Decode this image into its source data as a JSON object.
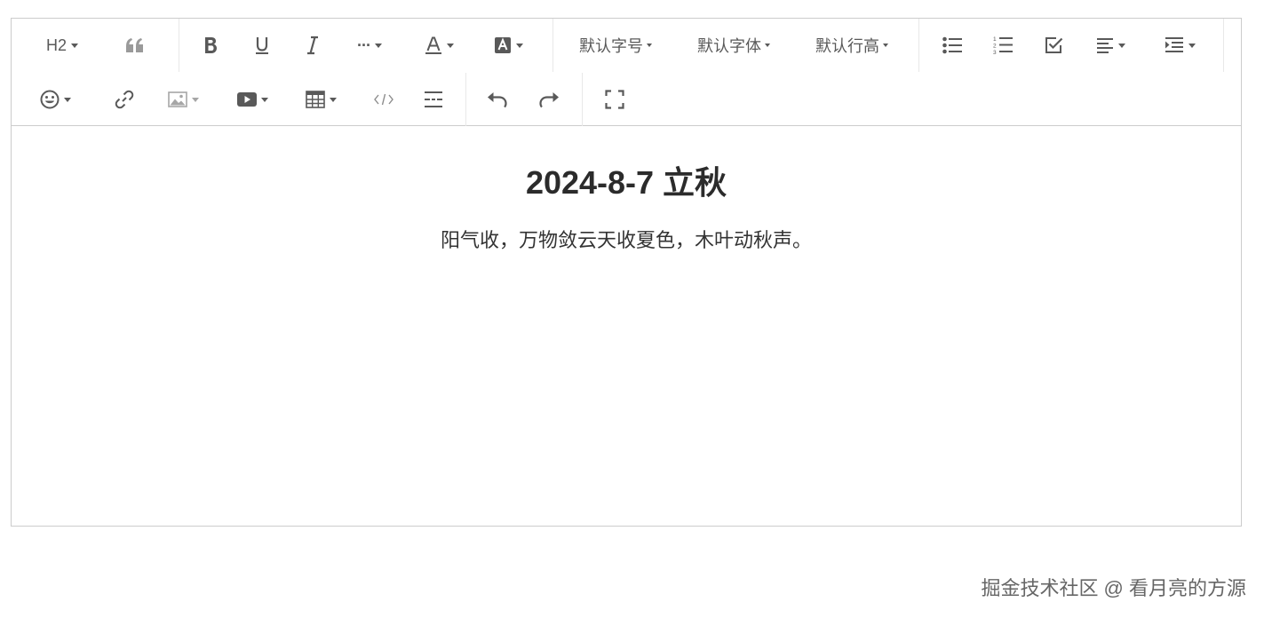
{
  "toolbar": {
    "heading_label": "H2",
    "font_size_label": "默认字号",
    "font_family_label": "默认字体",
    "line_height_label": "默认行高",
    "more_label": "···"
  },
  "document": {
    "title": "2024-8-7 立秋",
    "paragraph": "阳气收，万物敛云天收夏色，木叶动秋声。"
  },
  "watermark": "掘金技术社区 @ 看月亮的方源",
  "colors": {
    "icon": "#595959",
    "border": "#cccccc",
    "separator": "#e8e8e8",
    "text": "#333333"
  }
}
